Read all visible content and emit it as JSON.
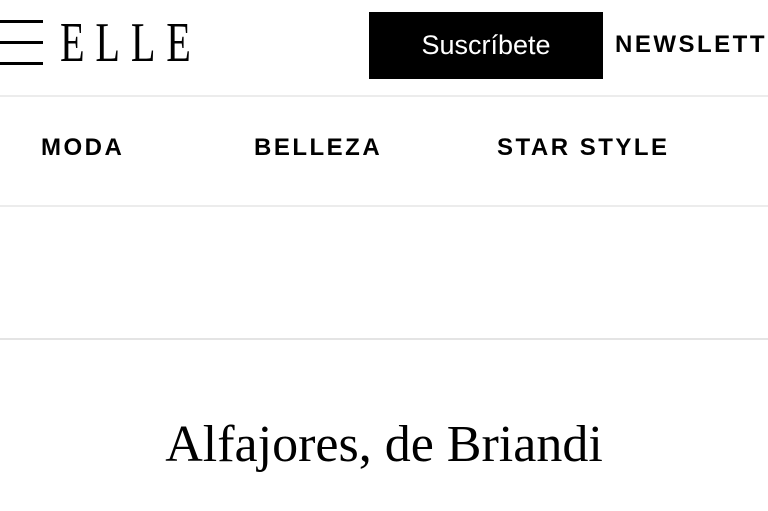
{
  "header": {
    "logo_text": "ELLE",
    "subscribe_label": "Suscríbete",
    "newsletter_label": "NEWSLETT"
  },
  "nav": {
    "items": [
      {
        "label": "MODA"
      },
      {
        "label": "BELLEZA"
      },
      {
        "label": "STAR STYLE"
      }
    ]
  },
  "article": {
    "title": "Alfajores, de Briandi"
  },
  "colors": {
    "text": "#000000",
    "background": "#ffffff",
    "subscribe_bg": "#000000",
    "subscribe_text": "#ffffff",
    "divider": "#ececec"
  },
  "icons": {
    "menu": "hamburger-menu-icon"
  }
}
